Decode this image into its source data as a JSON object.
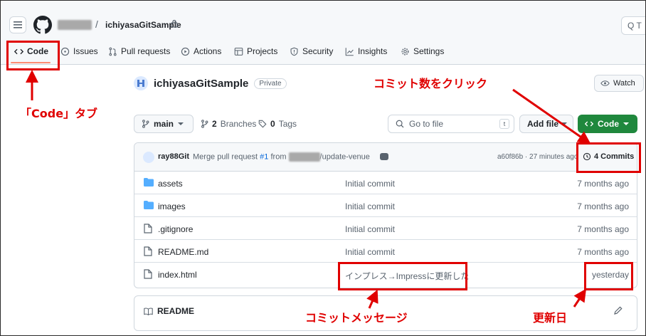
{
  "header": {
    "repo_crumb": "ichiyasaGitSample",
    "search_placeholder": "Q T"
  },
  "tabs": [
    {
      "label": "Code",
      "icon": "code-icon"
    },
    {
      "label": "Issues",
      "icon": "issue-icon"
    },
    {
      "label": "Pull requests",
      "icon": "pull-request-icon"
    },
    {
      "label": "Actions",
      "icon": "play-icon"
    },
    {
      "label": "Projects",
      "icon": "table-icon"
    },
    {
      "label": "Security",
      "icon": "shield-icon"
    },
    {
      "label": "Insights",
      "icon": "graph-icon"
    },
    {
      "label": "Settings",
      "icon": "gear-icon"
    }
  ],
  "repo": {
    "name": "ichiyasaGitSample",
    "visibility": "Private",
    "watch_label": "Watch"
  },
  "toolbar": {
    "branch": "main",
    "branches_count": "2",
    "branches_label": "Branches",
    "tags_count": "0",
    "tags_label": "Tags",
    "goto_placeholder": "Go to file",
    "goto_shortcut": "t",
    "add_file": "Add file",
    "code_button": "Code"
  },
  "latest_commit": {
    "user": "ray88Git",
    "message_prefix": "Merge pull request ",
    "pr_link": "#1",
    "message_from": " from ",
    "message_suffix": "/update-venue",
    "hash_time": "a60f86b · 27 minutes ago",
    "commits_label": "4 Commits"
  },
  "files": [
    {
      "name": "assets",
      "type": "folder",
      "message": "Initial commit",
      "date": "7 months ago"
    },
    {
      "name": "images",
      "type": "folder",
      "message": "Initial commit",
      "date": "7 months ago"
    },
    {
      "name": ".gitignore",
      "type": "file",
      "message": "Initial commit",
      "date": "7 months ago"
    },
    {
      "name": "README.md",
      "type": "file",
      "message": "Initial commit",
      "date": "7 months ago"
    },
    {
      "name": "index.html",
      "type": "file",
      "message": "インプレス→Impressに更新した",
      "date": "yesterday"
    }
  ],
  "readme": {
    "label": "README"
  },
  "annotations": {
    "code_tab": "「Code」タブ",
    "click_commits": "コミット数をクリック",
    "commit_message": "コミットメッセージ",
    "updated_date": "更新日"
  },
  "colors": {
    "annotation_red": "#e00000",
    "code_green": "#1f883d",
    "link_blue": "#0969da",
    "folder_blue": "#54aeff"
  }
}
